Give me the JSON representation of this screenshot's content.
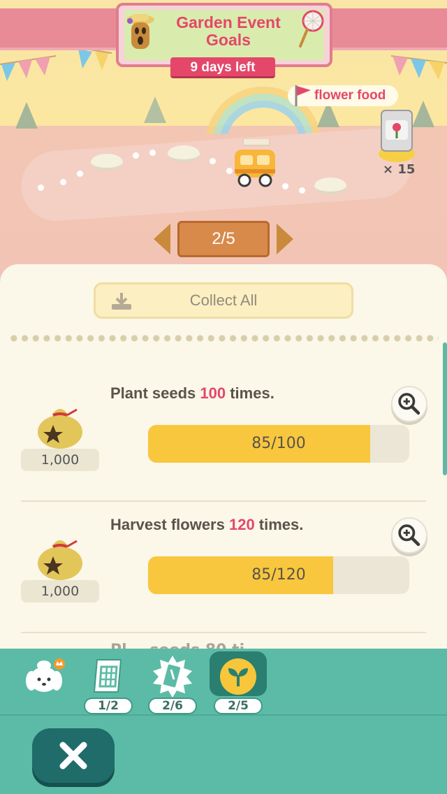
{
  "event": {
    "title": "Garden Event Goals",
    "days_left": "9 days left"
  },
  "reward_banner": {
    "label": "flower food",
    "count": "× 15"
  },
  "pager": {
    "current": "2/5"
  },
  "panel": {
    "collect_all": "Collect All",
    "goals": [
      {
        "text_before": "Plant seeds ",
        "number": "100",
        "text_after": " times.",
        "reward": "1,000",
        "progress_label": "85/100",
        "progress_fraction": 0.85
      },
      {
        "text_before": "Harvest flowers ",
        "number": "120",
        "text_after": " times.",
        "reward": "1,000",
        "progress_label": "85/120",
        "progress_fraction": 0.708
      }
    ],
    "peek_text": "Pl... seeds 80 ti..."
  },
  "tabs": [
    {
      "name": "isabelle",
      "badge": ""
    },
    {
      "name": "calendar",
      "badge": "1/2"
    },
    {
      "name": "event-ticket",
      "badge": "2/6"
    },
    {
      "name": "garden-sprout",
      "badge": "2/5",
      "active": true
    }
  ],
  "colors": {
    "accent_pink": "#e4476a",
    "progress_yellow": "#f8c73d",
    "teal": "#5cbba6",
    "dark_teal": "#1f6c6a"
  },
  "icons": [
    "mascot-icon",
    "net-icon",
    "flag-icon",
    "seed-bag-icon",
    "van-icon",
    "download-icon",
    "bell-bag-icon",
    "zoom-in-icon",
    "close-icon"
  ]
}
